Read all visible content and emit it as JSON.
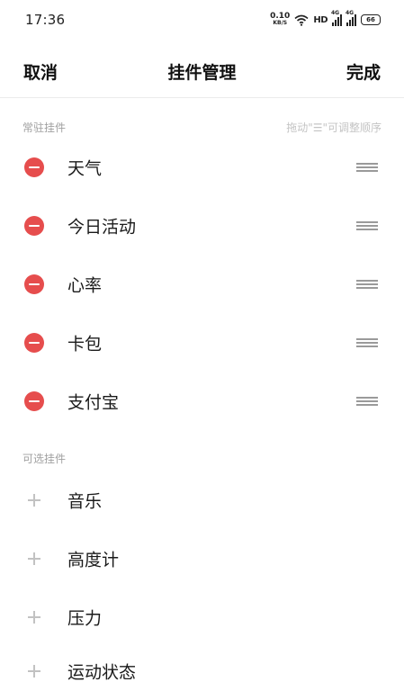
{
  "status_bar": {
    "time": "17:36",
    "net_speed_value": "0.10",
    "net_speed_unit": "KB/S",
    "hd_label": "HD",
    "sim1_label": "4G",
    "sim2_label": "4G",
    "battery": "66",
    "icons": [
      "wifi-icon",
      "signal-icon",
      "battery-icon"
    ]
  },
  "header": {
    "cancel": "取消",
    "title": "挂件管理",
    "done": "完成"
  },
  "resident": {
    "label": "常驻挂件",
    "hint": "拖动\"☰\"可调整顺序",
    "items": [
      {
        "label": "天气"
      },
      {
        "label": "今日活动"
      },
      {
        "label": "心率"
      },
      {
        "label": "卡包"
      },
      {
        "label": "支付宝"
      }
    ]
  },
  "optional": {
    "label": "可选挂件",
    "items": [
      {
        "label": "音乐"
      },
      {
        "label": "高度计"
      },
      {
        "label": "压力"
      },
      {
        "label": "运动状态"
      }
    ]
  },
  "colors": {
    "remove": "#e64d4d",
    "add": "#c2c2c2",
    "section_label": "#a0a0a0"
  }
}
